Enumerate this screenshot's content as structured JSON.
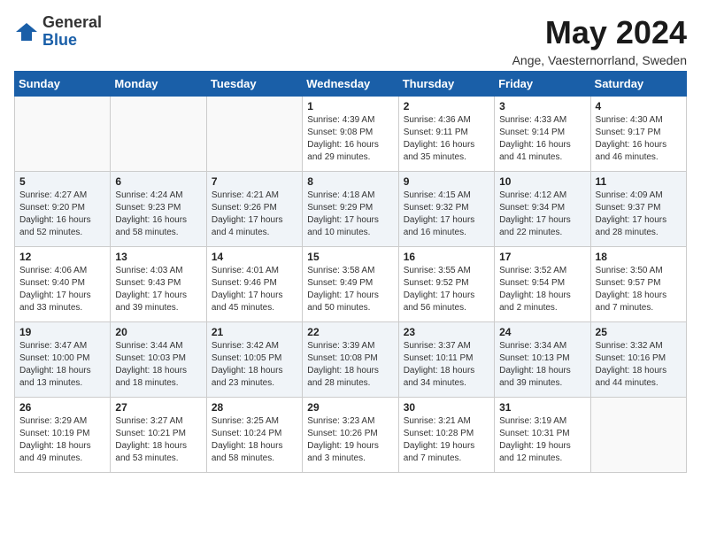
{
  "logo": {
    "general": "General",
    "blue": "Blue"
  },
  "title": "May 2024",
  "location": "Ange, Vaesternorrland, Sweden",
  "weekdays": [
    "Sunday",
    "Monday",
    "Tuesday",
    "Wednesday",
    "Thursday",
    "Friday",
    "Saturday"
  ],
  "weeks": [
    [
      {
        "day": "",
        "info": ""
      },
      {
        "day": "",
        "info": ""
      },
      {
        "day": "",
        "info": ""
      },
      {
        "day": "1",
        "info": "Sunrise: 4:39 AM\nSunset: 9:08 PM\nDaylight: 16 hours\nand 29 minutes."
      },
      {
        "day": "2",
        "info": "Sunrise: 4:36 AM\nSunset: 9:11 PM\nDaylight: 16 hours\nand 35 minutes."
      },
      {
        "day": "3",
        "info": "Sunrise: 4:33 AM\nSunset: 9:14 PM\nDaylight: 16 hours\nand 41 minutes."
      },
      {
        "day": "4",
        "info": "Sunrise: 4:30 AM\nSunset: 9:17 PM\nDaylight: 16 hours\nand 46 minutes."
      }
    ],
    [
      {
        "day": "5",
        "info": "Sunrise: 4:27 AM\nSunset: 9:20 PM\nDaylight: 16 hours\nand 52 minutes."
      },
      {
        "day": "6",
        "info": "Sunrise: 4:24 AM\nSunset: 9:23 PM\nDaylight: 16 hours\nand 58 minutes."
      },
      {
        "day": "7",
        "info": "Sunrise: 4:21 AM\nSunset: 9:26 PM\nDaylight: 17 hours\nand 4 minutes."
      },
      {
        "day": "8",
        "info": "Sunrise: 4:18 AM\nSunset: 9:29 PM\nDaylight: 17 hours\nand 10 minutes."
      },
      {
        "day": "9",
        "info": "Sunrise: 4:15 AM\nSunset: 9:32 PM\nDaylight: 17 hours\nand 16 minutes."
      },
      {
        "day": "10",
        "info": "Sunrise: 4:12 AM\nSunset: 9:34 PM\nDaylight: 17 hours\nand 22 minutes."
      },
      {
        "day": "11",
        "info": "Sunrise: 4:09 AM\nSunset: 9:37 PM\nDaylight: 17 hours\nand 28 minutes."
      }
    ],
    [
      {
        "day": "12",
        "info": "Sunrise: 4:06 AM\nSunset: 9:40 PM\nDaylight: 17 hours\nand 33 minutes."
      },
      {
        "day": "13",
        "info": "Sunrise: 4:03 AM\nSunset: 9:43 PM\nDaylight: 17 hours\nand 39 minutes."
      },
      {
        "day": "14",
        "info": "Sunrise: 4:01 AM\nSunset: 9:46 PM\nDaylight: 17 hours\nand 45 minutes."
      },
      {
        "day": "15",
        "info": "Sunrise: 3:58 AM\nSunset: 9:49 PM\nDaylight: 17 hours\nand 50 minutes."
      },
      {
        "day": "16",
        "info": "Sunrise: 3:55 AM\nSunset: 9:52 PM\nDaylight: 17 hours\nand 56 minutes."
      },
      {
        "day": "17",
        "info": "Sunrise: 3:52 AM\nSunset: 9:54 PM\nDaylight: 18 hours\nand 2 minutes."
      },
      {
        "day": "18",
        "info": "Sunrise: 3:50 AM\nSunset: 9:57 PM\nDaylight: 18 hours\nand 7 minutes."
      }
    ],
    [
      {
        "day": "19",
        "info": "Sunrise: 3:47 AM\nSunset: 10:00 PM\nDaylight: 18 hours\nand 13 minutes."
      },
      {
        "day": "20",
        "info": "Sunrise: 3:44 AM\nSunset: 10:03 PM\nDaylight: 18 hours\nand 18 minutes."
      },
      {
        "day": "21",
        "info": "Sunrise: 3:42 AM\nSunset: 10:05 PM\nDaylight: 18 hours\nand 23 minutes."
      },
      {
        "day": "22",
        "info": "Sunrise: 3:39 AM\nSunset: 10:08 PM\nDaylight: 18 hours\nand 28 minutes."
      },
      {
        "day": "23",
        "info": "Sunrise: 3:37 AM\nSunset: 10:11 PM\nDaylight: 18 hours\nand 34 minutes."
      },
      {
        "day": "24",
        "info": "Sunrise: 3:34 AM\nSunset: 10:13 PM\nDaylight: 18 hours\nand 39 minutes."
      },
      {
        "day": "25",
        "info": "Sunrise: 3:32 AM\nSunset: 10:16 PM\nDaylight: 18 hours\nand 44 minutes."
      }
    ],
    [
      {
        "day": "26",
        "info": "Sunrise: 3:29 AM\nSunset: 10:19 PM\nDaylight: 18 hours\nand 49 minutes."
      },
      {
        "day": "27",
        "info": "Sunrise: 3:27 AM\nSunset: 10:21 PM\nDaylight: 18 hours\nand 53 minutes."
      },
      {
        "day": "28",
        "info": "Sunrise: 3:25 AM\nSunset: 10:24 PM\nDaylight: 18 hours\nand 58 minutes."
      },
      {
        "day": "29",
        "info": "Sunrise: 3:23 AM\nSunset: 10:26 PM\nDaylight: 19 hours\nand 3 minutes."
      },
      {
        "day": "30",
        "info": "Sunrise: 3:21 AM\nSunset: 10:28 PM\nDaylight: 19 hours\nand 7 minutes."
      },
      {
        "day": "31",
        "info": "Sunrise: 3:19 AM\nSunset: 10:31 PM\nDaylight: 19 hours\nand 12 minutes."
      },
      {
        "day": "",
        "info": ""
      }
    ]
  ]
}
